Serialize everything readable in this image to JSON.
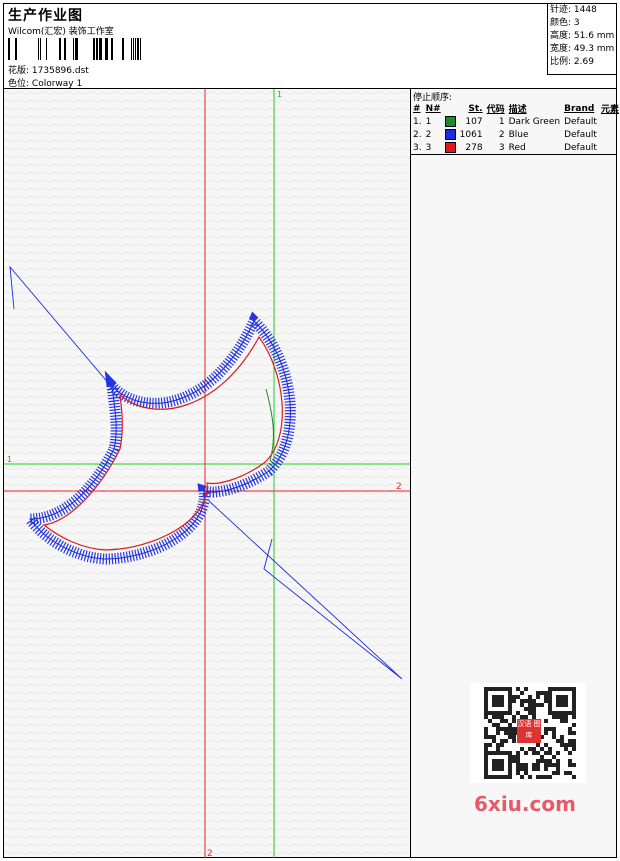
{
  "header": {
    "title": "生产作业图",
    "company": "Wilcom(汇宏) 装饰工作室",
    "design_label": "花版:",
    "design_value": "1735896.dst",
    "colorway_label": "色位:",
    "colorway_value": "Colorway 1"
  },
  "stats": {
    "stitches": "针迹: 1448",
    "colors": "颜色: 3",
    "height": "高度: 51.6 mm",
    "width": "宽度: 49.3 mm",
    "scale": "比例: 2.69"
  },
  "stop_sequence": {
    "title": "停止顺序:",
    "columns": [
      "#",
      "N#",
      "St.",
      "代码",
      "描述",
      "Brand",
      "元素"
    ],
    "rows": [
      {
        "num": "1.",
        "n": "1",
        "color": "#1f8a2a",
        "st": "107",
        "code": "1",
        "desc": "Dark Green",
        "brand": "Default",
        "element": ""
      },
      {
        "num": "2.",
        "n": "2",
        "color": "#1a2be0",
        "st": "1061",
        "code": "2",
        "desc": "Blue",
        "brand": "Default",
        "element": ""
      },
      {
        "num": "3.",
        "n": "3",
        "color": "#e01a1a",
        "st": "278",
        "code": "3",
        "desc": "Red",
        "brand": "Default",
        "element": ""
      }
    ]
  },
  "guides": {
    "green_label_vertical": "1",
    "green_label_horizontal": "1",
    "red_label_horizontal": "2",
    "red_label_vertical": "2"
  },
  "colors": {
    "guide_green": "#22cc22",
    "guide_red": "#ee2222",
    "stitch_blue": "#1a2be0",
    "stitch_red": "#e01a1a",
    "stitch_green": "#1f8a2a"
  },
  "watermark": {
    "text": "6xiu.com",
    "seal_text": "汉语 图库"
  }
}
